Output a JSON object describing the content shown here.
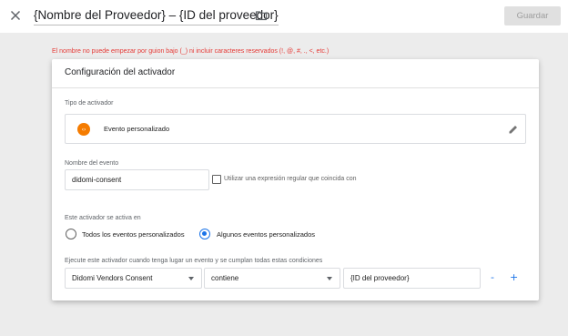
{
  "header": {
    "title": "{Nombre del Proveedor} – {ID del proveedor}",
    "save_label": "Guardar"
  },
  "error_message": "El nombre no puede empezar por guion bajo (_) ni incluir caracteres reservados (!, @, #, ., <, etc.)",
  "card": {
    "title": "Configuración del activador",
    "trigger_type": {
      "label": "Tipo de activador",
      "icon": "code-brackets-icon",
      "icon_color": "#f57c00",
      "name": "Evento personalizado"
    },
    "event_name": {
      "label": "Nombre del evento",
      "value": "didomi-consent",
      "regex_label": "Utilizar una expresión regular que coincida con",
      "regex_checked": false
    },
    "fires_on": {
      "label": "Este activador se activa en",
      "options": [
        "Todos los eventos personalizados",
        "Algunos eventos personalizados"
      ],
      "selected": "Algunos eventos personalizados"
    },
    "condition": {
      "label": "Ejecute este activador cuando tenga lugar un evento y se cumplan todas estas condiciones",
      "variable": "Didomi Vendors Consent",
      "operator": "contiene",
      "value": "{ID del proveedor}",
      "remove_label": "-",
      "add_label": "+"
    }
  },
  "colors": {
    "accent": "#1a73e8",
    "error": "#e53935"
  }
}
